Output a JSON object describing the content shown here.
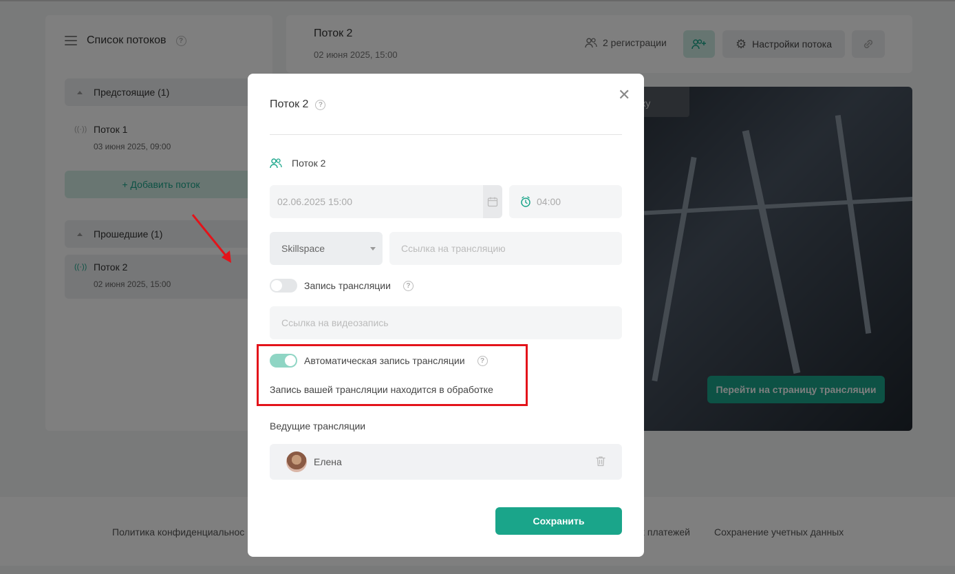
{
  "sidebar": {
    "title": "Список потоков",
    "upcoming_group": "Предстоящие (1)",
    "past_group": "Прошедшие (1)",
    "add_button": "+ Добавить поток",
    "streams": [
      {
        "name": "Поток 1",
        "date": "03 июня 2025, 09:00"
      },
      {
        "name": "Поток 2",
        "date": "02 июня 2025, 15:00"
      }
    ]
  },
  "header": {
    "title": "Поток 2",
    "date": "02 июня 2025, 15:00",
    "registrations": "2 регистрации",
    "settings_button": "Настройки потока"
  },
  "hero": {
    "tooltip": "кку",
    "go_button": "Перейти на страницу трансляции"
  },
  "footer": {
    "links": [
      "Политика конфиденциальнос",
      "х платежей",
      "Сохранение учетных данных"
    ]
  },
  "modal": {
    "title": "Поток 2",
    "stream_name": "Поток 2",
    "date_value": "02.06.2025 15:00",
    "time_value": "04:00",
    "platform": "Skillspace",
    "stream_link_placeholder": "Ссылка на трансляцию",
    "recording_label": "Запись трансляции",
    "recording_on": false,
    "video_link_placeholder": "Ссылка на видеозапись",
    "auto_recording_label": "Автоматическая запись трансляции",
    "auto_recording_on": true,
    "processing_text": "Запись вашей трансляции находится в обработке",
    "hosts_label": "Ведущие трансляции",
    "host_name": "Елена",
    "save_button": "Сохранить"
  },
  "colors": {
    "accent": "#1aa58a",
    "highlight": "#e3131a"
  }
}
